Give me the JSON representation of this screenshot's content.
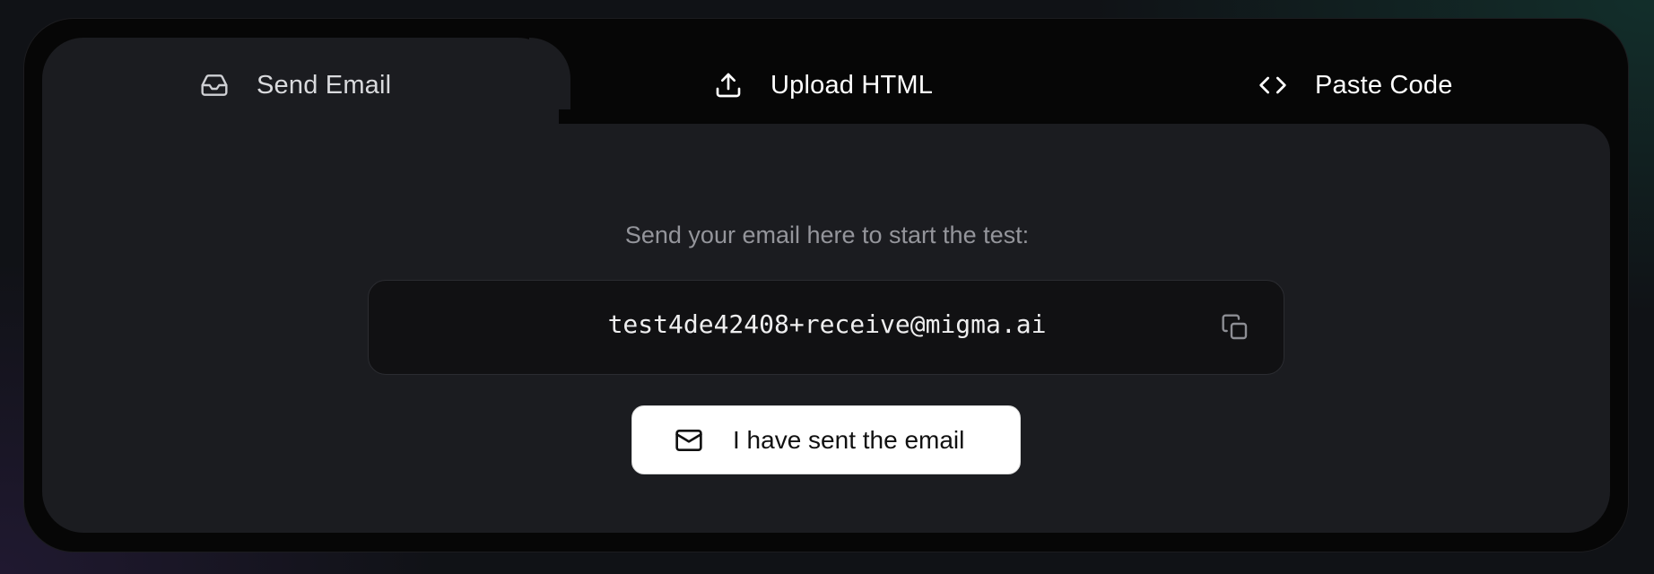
{
  "tabs": [
    {
      "label": "Send Email",
      "icon": "inbox-icon",
      "active": true
    },
    {
      "label": "Upload HTML",
      "icon": "upload-icon",
      "active": false
    },
    {
      "label": "Paste Code",
      "icon": "code-icon",
      "active": false
    }
  ],
  "main": {
    "instruction": "Send your email here to start the test:",
    "email_address": "test4de42408+receive@migma.ai",
    "copy_icon": "copy-icon",
    "sent_button_label": "I have sent the email",
    "sent_button_icon": "mail-icon"
  },
  "colors": {
    "panel": "#1b1c20",
    "outer": "#060606",
    "button_bg": "#ffffff"
  }
}
